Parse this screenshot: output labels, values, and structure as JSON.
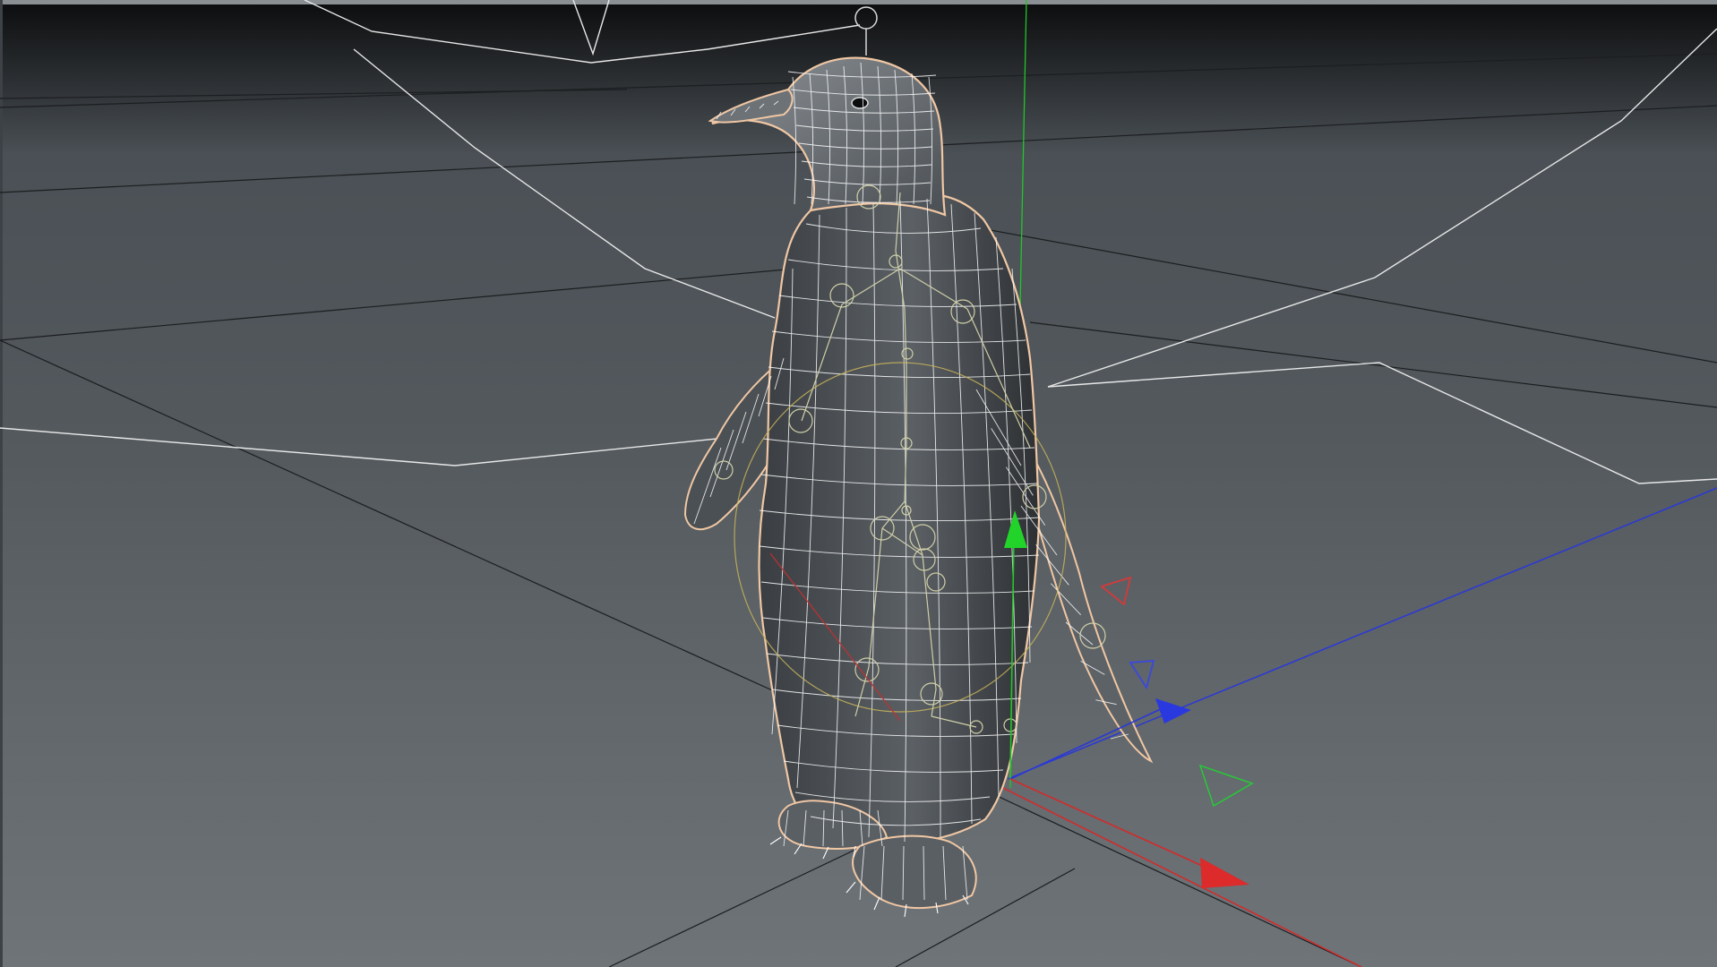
{
  "viewport": {
    "label": "",
    "colors": {
      "background_top": "#0b0c0d",
      "background_horizon": "#4a5055",
      "floor_near": "#6e7478",
      "floor_far": "#53595d",
      "mesh_wire": "#ffffff",
      "mesh_fill_dark": "#2a2d30",
      "mesh_fill_light": "#8a8f94",
      "selection_outline": "#f0c7a4",
      "rig_joint": "#cfcfa8",
      "rig_control": "#c8b45a",
      "axis_x": "#d42a2a",
      "axis_y": "#22c52a",
      "axis_z": "#2a38d8",
      "world_grid": "#1c1e20",
      "bound_lines": "#e8e8e8"
    }
  },
  "scene": {
    "object": "penguin-mesh",
    "display_mode": "wireframe-on-shaded",
    "selected": true
  },
  "gizmo": {
    "icons": [
      "move-gizmo-icon",
      "rotate-gizmo-icon",
      "scale-gizmo-icon"
    ],
    "axes": [
      "x",
      "y",
      "z"
    ]
  }
}
